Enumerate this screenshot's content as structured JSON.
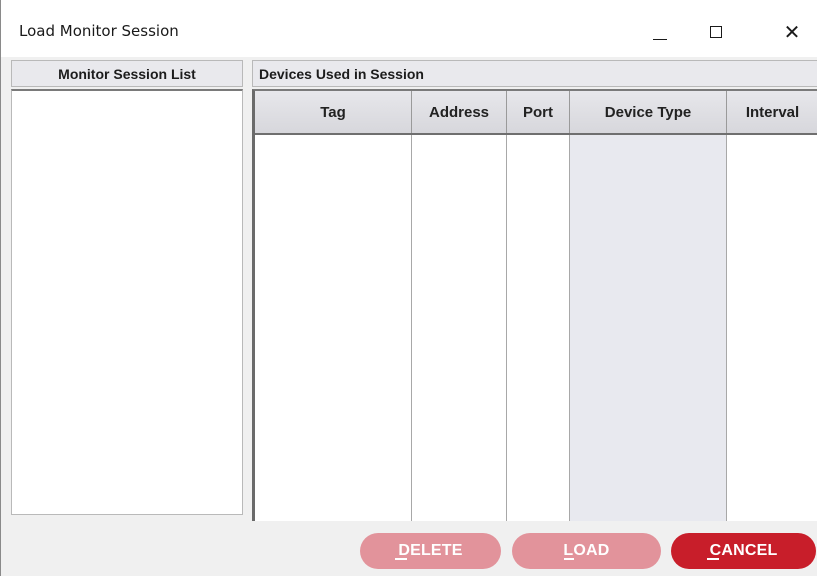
{
  "window": {
    "title": "Load Monitor Session",
    "controls": {
      "minimize": "minimize-icon",
      "maximize": "maximize-icon",
      "close": "close-icon",
      "close_glyph": "✕"
    }
  },
  "left_panel": {
    "header": "Monitor Session List",
    "items": []
  },
  "right_panel": {
    "header": "Devices Used in Session",
    "columns": [
      "Tag",
      "Address",
      "Port",
      "Device Type",
      "Interval"
    ],
    "rows": []
  },
  "buttons": {
    "delete": {
      "label": "DELETE",
      "enabled": false
    },
    "load": {
      "label": "LOAD",
      "enabled": false
    },
    "cancel": {
      "label": "CANCEL",
      "enabled": true
    }
  },
  "colors": {
    "button_enabled": "#c81e2a",
    "button_disabled": "#e2939b",
    "shaded_column": "#e8e9ef"
  }
}
